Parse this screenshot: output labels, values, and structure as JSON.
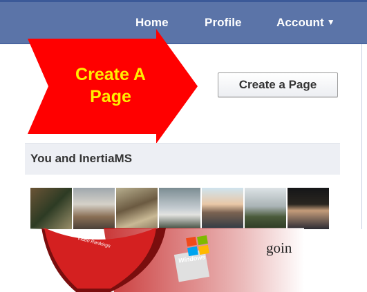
{
  "nav": {
    "home": "Home",
    "profile": "Profile",
    "account": "Account",
    "account_caret": "▼"
  },
  "annotation": {
    "line1": "Create A",
    "line2": "Page",
    "arrow_color": "#ff0000",
    "text_color": "#ffee00"
  },
  "create_page_button": "Create a Page",
  "section": {
    "title": "You and InertiaMS"
  },
  "photos_count": 7,
  "overlay": {
    "disc_text": "Video Rankings",
    "box_text": "Windows",
    "trailing_text": "goin"
  }
}
